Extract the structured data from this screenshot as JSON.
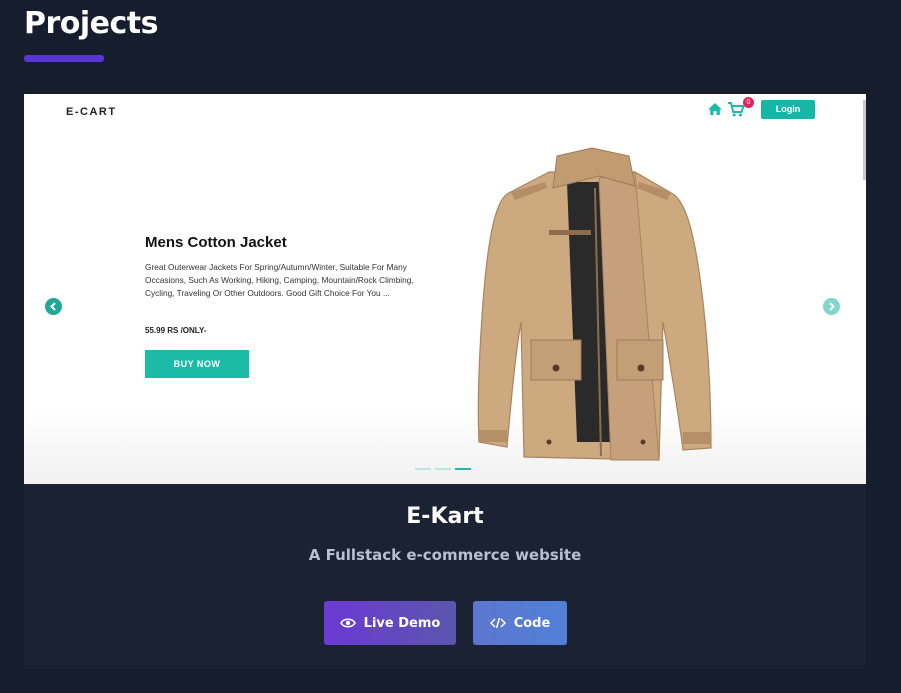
{
  "section": {
    "title": "Projects"
  },
  "preview": {
    "brand": "E-CART",
    "cart_count": "0",
    "login_label": "Login",
    "product": {
      "title": "Mens Cotton Jacket",
      "description": "Great Outerwear Jackets For Spring/Autumn/Winter, Suitable For Many Occasions, Such As Working, Hiking, Camping, Mountain/Rock Climbing, Cycling, Traveling Or Other Outdoors. Good Gift Choice For You ...",
      "price": "55.99 RS /ONLY-",
      "buy_label": "BUY NOW"
    },
    "carousel": {
      "slides": 3,
      "active_index": 2
    },
    "colors": {
      "accent": "#1cbba8",
      "badge": "#e2245e"
    }
  },
  "project": {
    "name": "E-Kart",
    "description": "A Fullstack e-commerce website",
    "live_demo_label": "Live Demo",
    "code_label": "Code"
  },
  "icons": [
    "home-icon",
    "cart-icon",
    "chevron-left-icon",
    "chevron-right-icon",
    "eye-icon",
    "code-icon"
  ],
  "colors": {
    "background": "#161d2c",
    "card": "#1b2234",
    "underline": "#5a35d6"
  }
}
